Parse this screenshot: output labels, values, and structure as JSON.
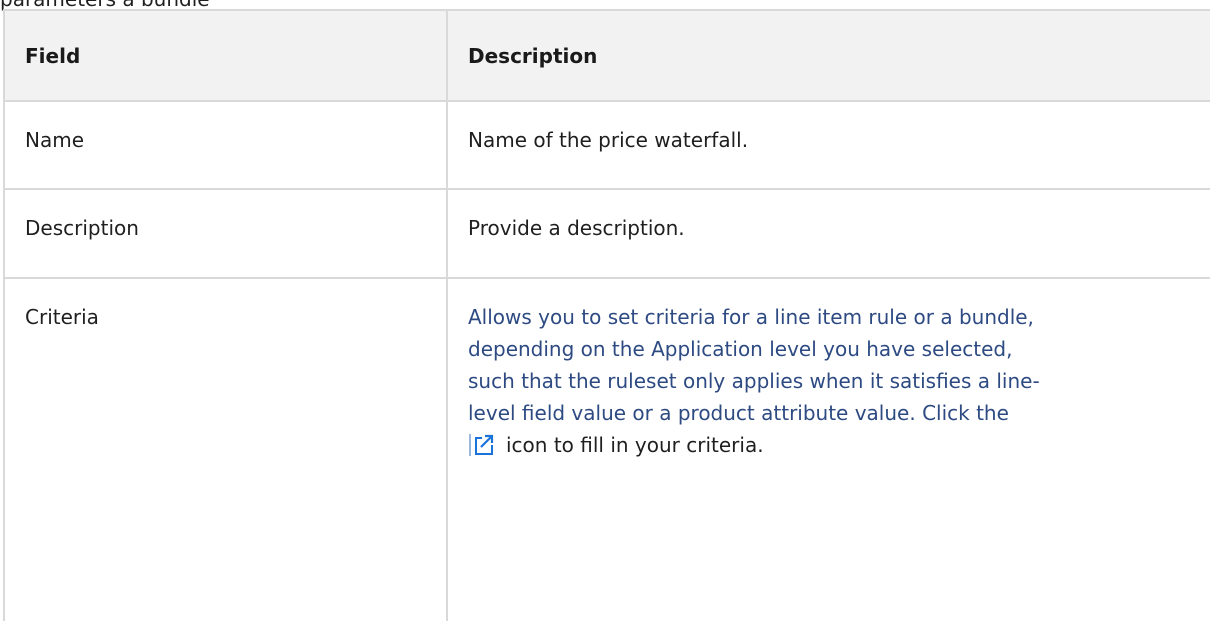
{
  "top_clipped_text": "parameters a bundle",
  "table": {
    "headers": [
      "Field",
      "Description"
    ],
    "rows": [
      {
        "field": "Name",
        "description": "Name of the price waterfall."
      },
      {
        "field": "Description",
        "description": "Provide a description."
      },
      {
        "field": "Criteria",
        "description_lines": [
          "Allows you to set criteria for a line item rule or a bundle,",
          "depending on the Application level you have selected,",
          "such that the ruleset only applies when it satisfies a line-",
          "level field value or a product attribute value. Click the"
        ],
        "description_tail": "icon to fill in your criteria.",
        "description_color": "#2d4a82",
        "icon": "external-edit-icon"
      }
    ]
  },
  "colors": {
    "header_bg": "#f2f2f2",
    "border": "#d9d9d9",
    "text": "#1f1f1f",
    "link_text": "#2d4a82",
    "icon_blue": "#1a73d9"
  }
}
